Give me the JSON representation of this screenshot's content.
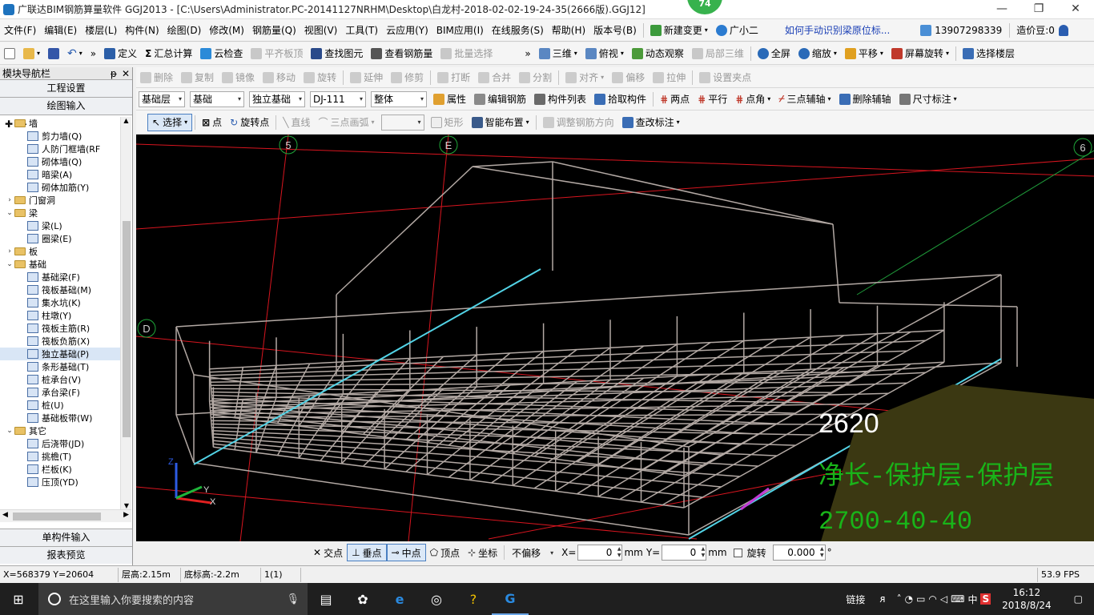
{
  "titlebar": {
    "title": "广联达BIM钢筋算量软件 GGJ2013 - [C:\\Users\\Administrator.PC-20141127NRHM\\Desktop\\白龙村-2018-02-02-19-24-35(2666版).GGJ12]",
    "badge": "74",
    "minimize": "—",
    "restore": "❐",
    "close": "✕"
  },
  "menu": {
    "items": [
      "文件(F)",
      "编辑(E)",
      "楼层(L)",
      "构件(N)",
      "绘图(D)",
      "修改(M)",
      "钢筋量(Q)",
      "视图(V)",
      "工具(T)",
      "云应用(Y)",
      "BIM应用(I)",
      "在线服务(S)",
      "帮助(H)",
      "版本号(B)"
    ],
    "new_change": "新建变更",
    "assistant": "广小二",
    "help_link": "如何手动识别梁原位标...",
    "phone": "13907298339",
    "beans": "造价豆:0"
  },
  "toolbar1": {
    "define": "定义",
    "sum": "汇总计算",
    "cloud_check": "云检查",
    "level_top": "平齐板顶",
    "find": "查找图元",
    "view_rebar": "查看钢筋量",
    "batch_select": "批量选择",
    "three_d": "三维",
    "top_view": "俯视",
    "dynamic": "动态观察",
    "local_3d": "局部三维",
    "fullscreen": "全屏",
    "zoom": "缩放",
    "pan": "平移",
    "rotate_screen": "屏幕旋转",
    "select_floor": "选择楼层"
  },
  "toolbar2": {
    "items": [
      "删除",
      "复制",
      "镜像",
      "移动",
      "旋转",
      "延伸",
      "修剪",
      "打断",
      "合并",
      "分割",
      "对齐",
      "偏移",
      "拉伸",
      "设置夹点"
    ]
  },
  "toolbar3": {
    "floor": "基础层",
    "category": "基础",
    "type": "独立基础",
    "component": "DJ-111",
    "part": "整体",
    "property": "属性",
    "edit_rebar": "编辑钢筋",
    "component_list": "构件列表",
    "pick": "拾取构件",
    "two_points": "两点",
    "parallel": "平行",
    "point_angle": "点角",
    "three_point_axis": "三点辅轴",
    "delete_axis": "删除辅轴",
    "dimension": "尺寸标注"
  },
  "toolbar4": {
    "select": "选择",
    "point": "点",
    "rotate_point": "旋转点",
    "line": "直线",
    "arc": "三点画弧",
    "rect": "矩形",
    "smart": "智能布置",
    "adjust_dir": "调整钢筋方向",
    "modify_label": "查改标注"
  },
  "navigator": {
    "title": "模块导航栏",
    "pin": "ᵽ",
    "close": "✕",
    "settings": "工程设置",
    "drawing": "绘图输入",
    "tree": [
      {
        "level": 0,
        "expand": "⌄",
        "folder": true,
        "label": "墙"
      },
      {
        "level": 1,
        "label": "剪力墙(Q)"
      },
      {
        "level": 1,
        "label": "人防门框墙(RF"
      },
      {
        "level": 1,
        "label": "砌体墙(Q)"
      },
      {
        "level": 1,
        "label": "暗梁(A)"
      },
      {
        "level": 1,
        "label": "砌体加筋(Y)"
      },
      {
        "level": 0,
        "expand": "›",
        "folder": true,
        "label": "门窗洞"
      },
      {
        "level": 0,
        "expand": "⌄",
        "folder": true,
        "label": "梁"
      },
      {
        "level": 1,
        "label": "梁(L)"
      },
      {
        "level": 1,
        "label": "圈梁(E)"
      },
      {
        "level": 0,
        "expand": "›",
        "folder": true,
        "label": "板"
      },
      {
        "level": 0,
        "expand": "⌄",
        "folder": true,
        "label": "基础"
      },
      {
        "level": 1,
        "label": "基础梁(F)"
      },
      {
        "level": 1,
        "label": "筏板基础(M)"
      },
      {
        "level": 1,
        "label": "集水坑(K)"
      },
      {
        "level": 1,
        "label": "柱墩(Y)"
      },
      {
        "level": 1,
        "label": "筏板主筋(R)"
      },
      {
        "level": 1,
        "label": "筏板负筋(X)"
      },
      {
        "level": 1,
        "label": "独立基础(P)",
        "selected": true
      },
      {
        "level": 1,
        "label": "条形基础(T)"
      },
      {
        "level": 1,
        "label": "桩承台(V)"
      },
      {
        "level": 1,
        "label": "承台梁(F)"
      },
      {
        "level": 1,
        "label": "桩(U)"
      },
      {
        "level": 1,
        "label": "基础板带(W)"
      },
      {
        "level": 0,
        "expand": "⌄",
        "folder": true,
        "label": "其它"
      },
      {
        "level": 1,
        "label": "后浇带(JD)"
      },
      {
        "level": 1,
        "label": "挑檐(T)"
      },
      {
        "level": 1,
        "label": "栏板(K)"
      },
      {
        "level": 1,
        "label": "压顶(YD)"
      }
    ],
    "single_input": "单构件输入",
    "report": "报表预览"
  },
  "viewport": {
    "axis_labels": [
      "5",
      "E",
      "6",
      "D"
    ],
    "overlay_number": "2620",
    "formula_text": "净长-保护层-保护层",
    "formula_values": "2700-40-40",
    "axis_x": "X",
    "axis_y": "Y",
    "axis_z": "Z"
  },
  "snapbar": {
    "intersect": "交点",
    "perpendicular": "垂点",
    "midpoint": "中点",
    "vertex": "顶点",
    "coord": "坐标",
    "offset_mode": "不偏移",
    "x_label": "X=",
    "x_value": "0",
    "unit1": "mm",
    "y_label": "Y=",
    "y_value": "0",
    "unit2": "mm",
    "rotate_label": "旋转",
    "rotate_value": "0.000",
    "deg": "°"
  },
  "status": {
    "coords": "X=568379 Y=20604",
    "floor_height": "层高:2.15m",
    "bottom_height": "底标高:-2.2m",
    "count": "1(1)",
    "fps": "53.9 FPS"
  },
  "taskbar": {
    "search_placeholder": "在这里输入你要搜索的内容",
    "tray_link": "链接",
    "ime": "中",
    "time": "16:12",
    "date": "2018/8/24"
  },
  "colors": {
    "viewport_bg": "#000000",
    "rebar": "#b3a9a4",
    "axis_red": "#d8151f",
    "axis_cyan": "#52d3e6",
    "overlay_olive": "#3b3812",
    "formula_green": "#19b419"
  }
}
